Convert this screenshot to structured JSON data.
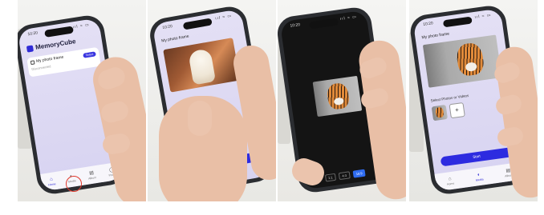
{
  "status": {
    "time": "10:20",
    "signal": "ııl ≈ ▭"
  },
  "panel1": {
    "brand": "MemoryCube",
    "card": {
      "title": "My photo frame",
      "subtitle": "Disconnected",
      "action": "Select"
    },
    "tabs": [
      {
        "label": "Home",
        "icon": "home-icon"
      },
      {
        "label": "Media",
        "icon": "media-icon"
      },
      {
        "label": "Album",
        "icon": "album-icon"
      },
      {
        "label": "Profile",
        "icon": "profile-icon"
      }
    ],
    "highlight_color": "#e0382c"
  },
  "panel2": {
    "title": "My photo frame",
    "section": "Select Photos or Videos"
  },
  "panel3": {
    "ratios": [
      "1:1",
      "4:3",
      "16:9"
    ],
    "active_ratio": "16:9"
  },
  "panel4": {
    "title": "My photo frame",
    "section": "Select Photos or Videos",
    "plus": "+",
    "start": "Start",
    "tabs": [
      {
        "label": "Home",
        "icon": "home-icon"
      },
      {
        "label": "Media",
        "icon": "media-icon"
      },
      {
        "label": "Album",
        "icon": "album-icon"
      }
    ]
  },
  "colors": {
    "accent": "#2d2be0",
    "dark_screen": "#141414"
  }
}
